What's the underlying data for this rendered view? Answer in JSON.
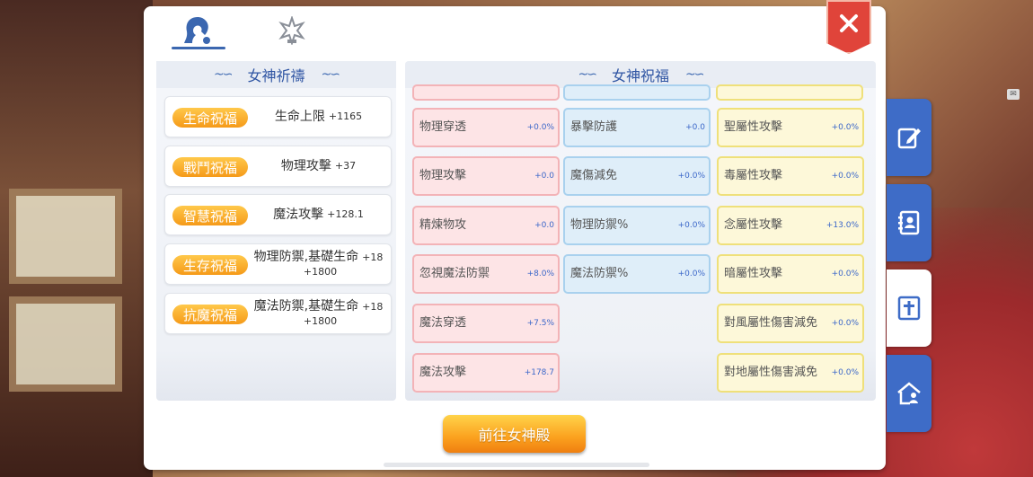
{
  "tabs": [
    {
      "name": "goddess-tab",
      "icon": "goddess-head-icon",
      "active": true
    },
    {
      "name": "emblem-tab",
      "icon": "emblem-icon",
      "active": false
    }
  ],
  "left": {
    "title": "女神祈禱",
    "rows": [
      {
        "badge": "生命祝福",
        "label": "生命上限",
        "value": "+1165"
      },
      {
        "badge": "戰鬥祝福",
        "label": "物理攻擊",
        "value": "+37"
      },
      {
        "badge": "智慧祝福",
        "label": "魔法攻擊",
        "value": "+128.1"
      },
      {
        "badge": "生存祝福",
        "label": "物理防禦,基礎生命",
        "value": "+18",
        "value2": "+1800"
      },
      {
        "badge": "抗魔祝福",
        "label": "魔法防禦,基礎生命",
        "value": "+18",
        "value2": "+1800"
      }
    ]
  },
  "right": {
    "title": "女神祝福",
    "pink": [
      {
        "label": "物理穿透",
        "value": "+0.0%"
      },
      {
        "label": "物理攻擊",
        "value": "+0.0"
      },
      {
        "label": "精煉物攻",
        "value": "+0.0"
      },
      {
        "label": "忽視魔法防禦",
        "value": "+8.0%"
      },
      {
        "label": "魔法穿透",
        "value": "+7.5%"
      },
      {
        "label": "魔法攻擊",
        "value": "+178.7"
      }
    ],
    "blue": [
      {
        "label": "暴擊防護",
        "value": "+0.0"
      },
      {
        "label": "魔傷減免",
        "value": "+0.0%"
      },
      {
        "label": "物理防禦%",
        "value": "+0.0%"
      },
      {
        "label": "魔法防禦%",
        "value": "+0.0%"
      }
    ],
    "yellow": [
      {
        "label": "聖屬性攻擊",
        "value": "+0.0%"
      },
      {
        "label": "毒屬性攻擊",
        "value": "+0.0%"
      },
      {
        "label": "念屬性攻擊",
        "value": "+13.0%"
      },
      {
        "label": "暗屬性攻擊",
        "value": "+0.0%"
      },
      {
        "label": "對風屬性傷害減免",
        "value": "+0.0%"
      },
      {
        "label": "對地屬性傷害減免",
        "value": "+0.0%"
      }
    ]
  },
  "button": {
    "label": "前往女神殿"
  },
  "side_tabs": [
    {
      "name": "edit",
      "icon": "edit-icon"
    },
    {
      "name": "contacts",
      "icon": "contact-book-icon"
    },
    {
      "name": "cross",
      "icon": "cross-icon",
      "active": true
    },
    {
      "name": "home",
      "icon": "home-person-icon"
    }
  ],
  "colors": {
    "accent": "#3b67b0",
    "badge": "#f59a19",
    "close": "#e0443a"
  }
}
